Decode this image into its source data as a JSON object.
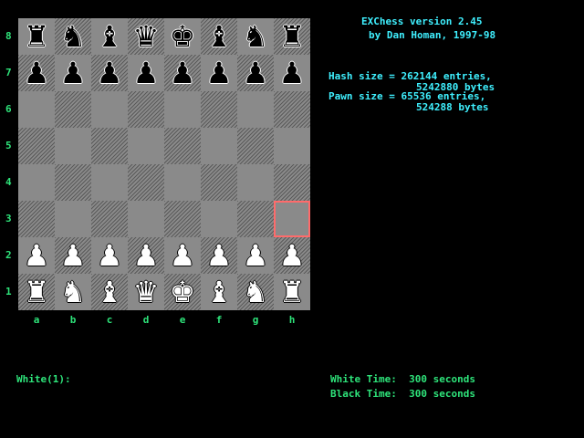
{
  "app": {
    "title_line": "EXChess version 2.45",
    "author_line": "by Dan Homan, 1997-98"
  },
  "settings": {
    "hash_line": "Hash size = 262144 entries,",
    "hash_bytes": "5242880 bytes",
    "pawn_line": "Pawn size = 65536 entries,",
    "pawn_bytes": "524288 bytes"
  },
  "prompt": {
    "text": "White(1):"
  },
  "clock": {
    "white": "White Time:  300 seconds",
    "black": "Black Time:  300 seconds"
  },
  "board": {
    "ranks": [
      "8",
      "7",
      "6",
      "5",
      "4",
      "3",
      "2",
      "1"
    ],
    "files": [
      "a",
      "b",
      "c",
      "d",
      "e",
      "f",
      "g",
      "h"
    ],
    "position": [
      [
        "r",
        "n",
        "b",
        "q",
        "k",
        "b",
        "n",
        "r"
      ],
      [
        "p",
        "p",
        "p",
        "p",
        "p",
        "p",
        "p",
        "p"
      ],
      [
        "",
        "",
        "",
        "",
        "",
        "",
        "",
        ""
      ],
      [
        "",
        "",
        "",
        "",
        "",
        "",
        "",
        ""
      ],
      [
        "",
        "",
        "",
        "",
        "",
        "",
        "",
        ""
      ],
      [
        "",
        "",
        "",
        "",
        "",
        "",
        "",
        ""
      ],
      [
        "P",
        "P",
        "P",
        "P",
        "P",
        "P",
        "P",
        "P"
      ],
      [
        "R",
        "N",
        "B",
        "Q",
        "K",
        "B",
        "N",
        "R"
      ]
    ],
    "selected_square": "h3",
    "colors": {
      "cursor": "#ff6b6b",
      "coord": "#2ee37a",
      "info": "#3ff0ff"
    }
  }
}
